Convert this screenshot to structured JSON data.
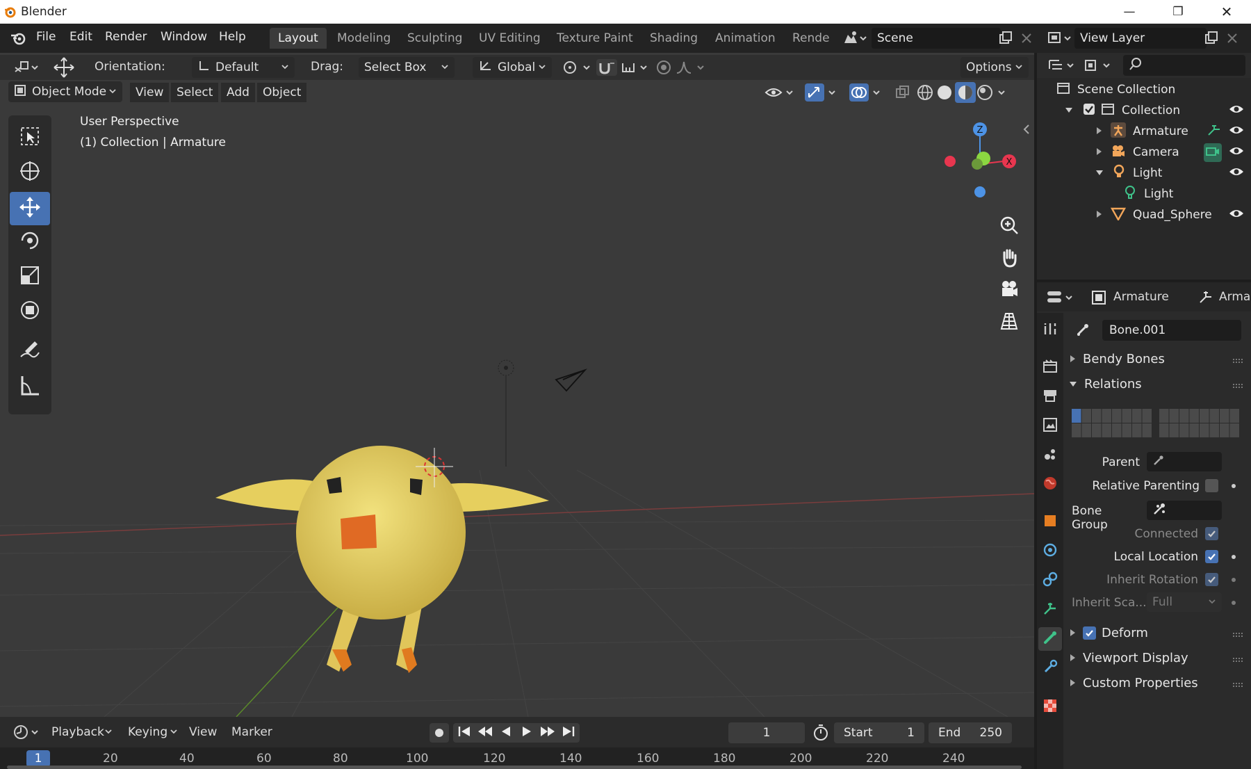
{
  "window": {
    "title": "Blender",
    "minimize": "—",
    "restore": "❐",
    "close": "✕"
  },
  "menu": {
    "file": "File",
    "edit": "Edit",
    "render": "Render",
    "window": "Window",
    "help": "Help"
  },
  "workspaces": [
    {
      "label": "Layout",
      "active": true
    },
    {
      "label": "Modeling"
    },
    {
      "label": "Sculpting"
    },
    {
      "label": "UV Editing"
    },
    {
      "label": "Texture Paint"
    },
    {
      "label": "Shading"
    },
    {
      "label": "Animation"
    },
    {
      "label": "Rende"
    }
  ],
  "scene": {
    "name": "Scene"
  },
  "view_layer": {
    "name": "View Layer"
  },
  "tool_header": {
    "orientation_label": "Orientation:",
    "orientation_value": "Default",
    "drag_label": "Drag:",
    "drag_value": "Select Box",
    "transform_value": "Global",
    "options": "Options"
  },
  "viewport_header": {
    "mode": "Object Mode",
    "view": "View",
    "select": "Select",
    "add": "Add",
    "object": "Object"
  },
  "viewport": {
    "perspective": "User Perspective",
    "context": "(1) Collection | Armature"
  },
  "gizmo": {
    "z": "Z",
    "x": "X",
    "y": "Y"
  },
  "timeline": {
    "playback": "Playback",
    "keying": "Keying",
    "view": "View",
    "marker": "Marker",
    "current_frame": "1",
    "start_label": "Start",
    "start_value": "1",
    "end_label": "End",
    "end_value": "250",
    "ticks": [
      "20",
      "40",
      "60",
      "80",
      "100",
      "120",
      "140",
      "160",
      "180",
      "200",
      "220",
      "240"
    ],
    "playhead": "1"
  },
  "outliner": {
    "root": "Scene Collection",
    "items": [
      {
        "label": "Collection"
      },
      {
        "label": "Armature"
      },
      {
        "label": "Camera"
      },
      {
        "label": "Light"
      },
      {
        "label": "Light"
      },
      {
        "label": "Quad_Sphere"
      }
    ]
  },
  "properties": {
    "object_name": "Armature",
    "armature_crumb": "Arma",
    "bone_name": "Bone.001",
    "panels": {
      "bendy": "Bendy Bones",
      "relations": "Relations",
      "deform": "Deform",
      "viewport_display": "Viewport Display",
      "custom_props": "Custom Properties"
    },
    "relations": {
      "parent": "Parent",
      "relative_parenting": "Relative Parenting",
      "bone_group": "Bone Group",
      "connected": "Connected",
      "local_location": "Local Location",
      "inherit_rotation": "Inherit Rotation",
      "inherit_scale": "Inherit Sca...",
      "inherit_scale_value": "Full"
    }
  },
  "colors": {
    "accent": "#4772b3",
    "viewport": "#3a3a3a",
    "x_axis": "#e8364f",
    "y_axis": "#8bd641",
    "z_axis": "#4d93e6"
  }
}
